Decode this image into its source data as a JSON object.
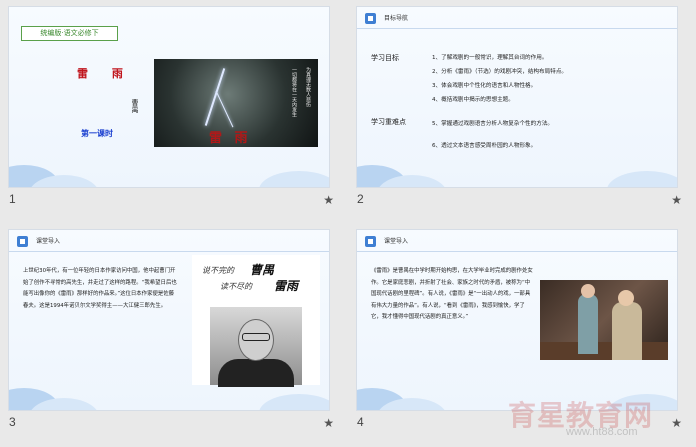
{
  "slides": [
    {
      "number": "1",
      "tag": "统编版·语文必修下",
      "title": "雷 雨",
      "author": "曹禺",
      "lesson": "第一课时",
      "poster": {
        "title": "雷 雨",
        "col_left": "一切都将在一天内发生",
        "col_right": "为真理无数人悲伤"
      }
    },
    {
      "number": "2",
      "header": "目标导航",
      "goals_label": "学习目标",
      "focus_label": "学习重难点",
      "items": [
        "1、了解戏剧的一般常识，理解其台词的作用。",
        "2、分析《雷雨》（节选）的戏剧冲突，结构布局特点。",
        "3、体会戏剧中个性化的语言和人物性格。",
        "4、概括戏剧中揭示的思想主题。",
        "5、掌握通过戏剧语言分析人物复杂个性的方法。",
        "6、透过文本语言感受周朴园的人物形象。"
      ]
    },
    {
      "number": "3",
      "header": "课堂导入",
      "text": "上世纪30年代，有一位年轻的日本作家访问中国，他中起曹门开始了创作不寻常的高先生，并走过了这样的路程。“我希望日后也能写出像你的《雷雨》那样好的作品来。”这位日本作家便是佐藤春夫。这是1994年诺贝尔文学奖得主——大江健三郎先生。",
      "calligraphy": [
        "说不完的",
        "曹禺",
        "读不尽的",
        "雷雨"
      ]
    },
    {
      "number": "4",
      "header": "课堂导入",
      "text": "《雷雨》是曹禺在中学时期开始构思，在大学毕业时完成的剧作处女作。它是家庭悲剧，并折射了社会、家族之时代的矛盾，被称为“中国现代话剧的里程碑”。有人说，《雷雨》是“一出动人的戏，一部具有伟大力量的作品”。有人说，“看到《雷雨》，我感到愉快，学了它，我才懂得中国现代话剧的真正意义。”"
    }
  ],
  "star": "★",
  "watermark": {
    "text": "育星教育网",
    "url": "www.ht88.com"
  }
}
